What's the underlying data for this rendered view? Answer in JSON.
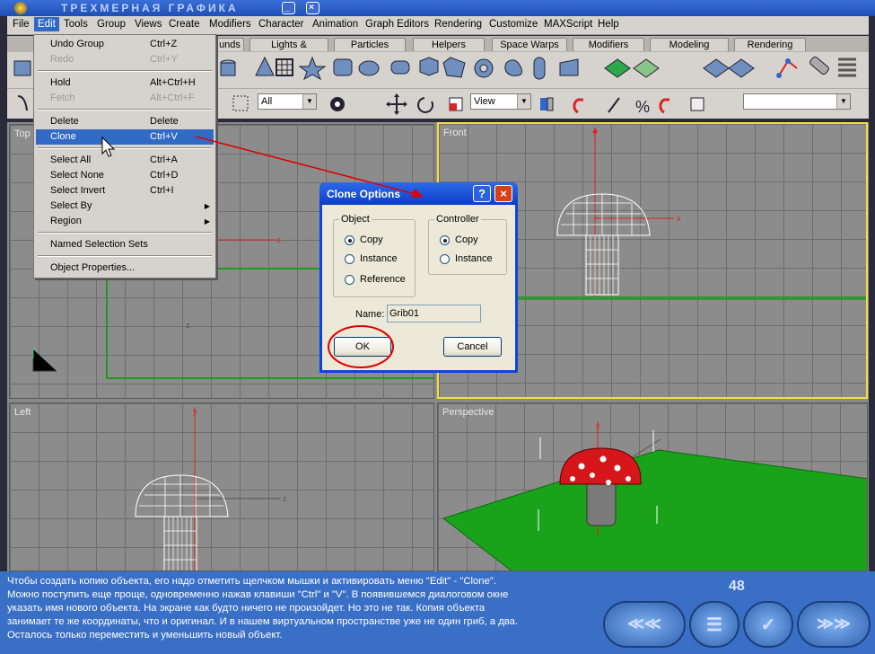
{
  "window": {
    "title": "ТРЕХМЕРНАЯ ГРАФИКА",
    "minimize": "_",
    "close": "×"
  },
  "menubar": [
    "File",
    "Edit",
    "Tools",
    "Group",
    "Views",
    "Create",
    "Modifiers",
    "Character",
    "Animation",
    "Graph Editors",
    "Rendering",
    "Customize",
    "MAXScript",
    "Help"
  ],
  "tabs": [
    "unds",
    "Lights & Cameras",
    "Particles",
    "Helpers",
    "Space Warps",
    "Modifiers",
    "Modeling",
    "Rendering"
  ],
  "toolbar": {
    "selection_filter": "All",
    "coord_system": "View"
  },
  "edit_menu": {
    "items": [
      {
        "label": "Undo Group",
        "key": "Ctrl+Z"
      },
      {
        "label": "Redo",
        "key": "Ctrl+Y",
        "disabled": true
      },
      {
        "label": "Hold",
        "key": "Alt+Ctrl+H"
      },
      {
        "label": "Fetch",
        "key": "Alt+Ctrl+F",
        "disabled": true
      },
      {
        "label": "Delete",
        "key": "Delete"
      },
      {
        "label": "Clone",
        "key": "Ctrl+V",
        "selected": true
      },
      {
        "label": "Select All",
        "key": "Ctrl+A"
      },
      {
        "label": "Select None",
        "key": "Ctrl+D"
      },
      {
        "label": "Select Invert",
        "key": "Ctrl+I"
      },
      {
        "label": "Select By",
        "key": ""
      },
      {
        "label": "Region",
        "key": ""
      },
      {
        "label": "Named Selection Sets",
        "key": ""
      },
      {
        "label": "Object Properties...",
        "key": ""
      }
    ]
  },
  "viewports": {
    "top": "Top",
    "front": "Front",
    "left": "Left",
    "perspective": "Perspective"
  },
  "axes": {
    "x": "x",
    "y": "y",
    "z": "z"
  },
  "clone_dialog": {
    "title": "Clone Options",
    "help": "?",
    "close": "×",
    "object_group": "Object",
    "object_options": [
      "Copy",
      "Instance",
      "Reference"
    ],
    "controller_group": "Controller",
    "controller_options": [
      "Copy",
      "Instance"
    ],
    "name_label": "Name:",
    "name_value": "Grib01",
    "ok": "OK",
    "cancel": "Cancel"
  },
  "tutorial": {
    "lines": [
      "Чтобы создать копию объекта, его надо отметить щелчком мышки и активировать меню \"Edit\" - \"Clone\".",
      "Можно поступить еще проще, одновременно нажав клавиши \"Ctrl\" и \"V\". В появившемся диалоговом окне",
      "указать имя нового объекта. На экране как будто ничего не произойдет. Но это не так. Копия объекта",
      "занимает те же координаты, что и оригинал. И в нашем виртуальном пространстве уже не один гриб, а два.",
      "Осталось только переместить и уменьшить новый объект."
    ],
    "page": "48"
  },
  "colors": {
    "accent": "#316ac5",
    "ground": "#1aa31a",
    "mushroom_cap": "#d6161b",
    "active_border": "#f1df43",
    "annotation": "#e00000"
  }
}
